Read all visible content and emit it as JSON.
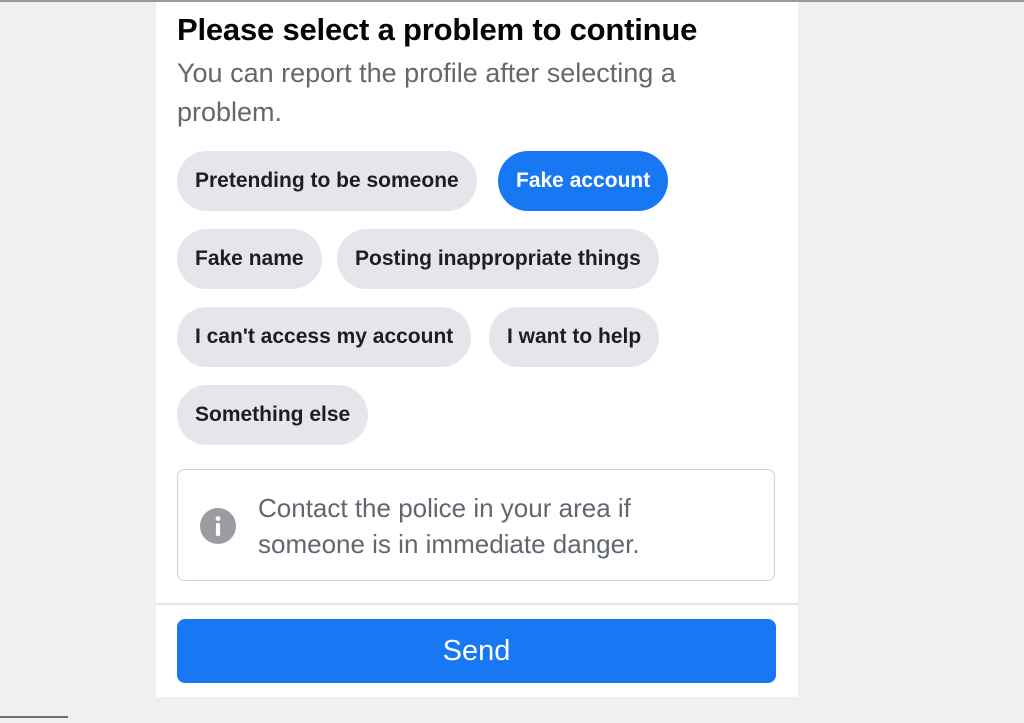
{
  "dialog": {
    "heading": "Please select a problem to continue",
    "subtext": "You can report the profile after selecting a problem.",
    "options": [
      {
        "label": "Pretending to be someone",
        "selected": false
      },
      {
        "label": "Fake account",
        "selected": true
      },
      {
        "label": "Fake name",
        "selected": false
      },
      {
        "label": "Posting inappropriate things",
        "selected": false
      },
      {
        "label": "I can't access my account",
        "selected": false
      },
      {
        "label": "I want to help",
        "selected": false
      },
      {
        "label": "Something else",
        "selected": false
      }
    ],
    "notice": {
      "icon": "info-icon",
      "text": "Contact the police in your area if someone is in immediate danger."
    },
    "send_label": "Send"
  },
  "colors": {
    "accent": "#1877f2",
    "chip_background": "#e4e6eb",
    "page_background": "#f0f0f0"
  }
}
